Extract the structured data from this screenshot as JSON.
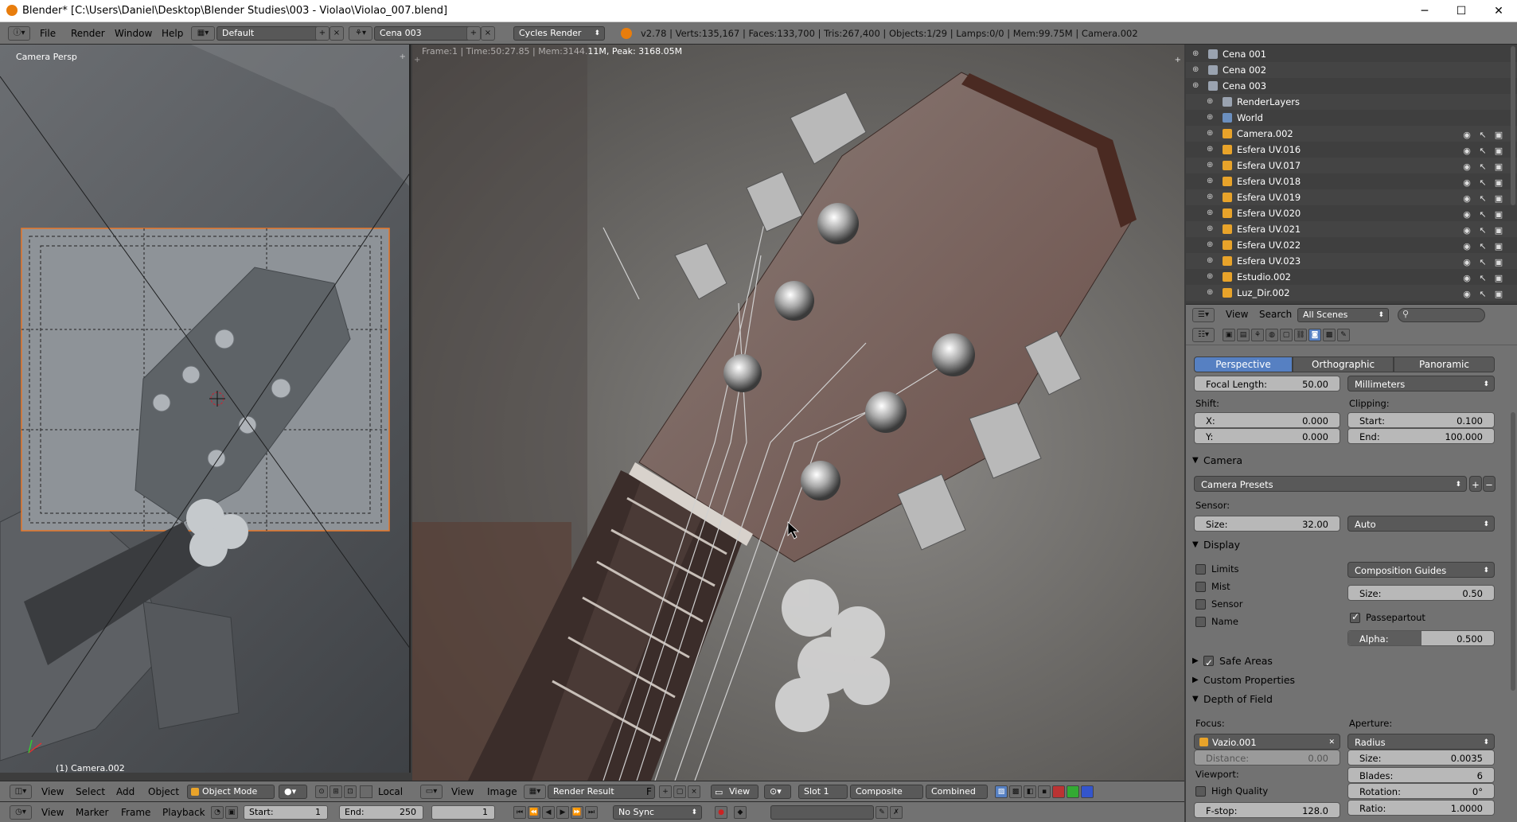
{
  "window": {
    "title": "Blender* [C:\\Users\\Daniel\\Desktop\\Blender Studies\\003 - Violao\\Violao_007.blend]",
    "minimize": "─",
    "maximize": "☐",
    "close": "✕"
  },
  "info_header": {
    "menus": [
      "File",
      "Render",
      "Window",
      "Help"
    ],
    "layout": "Default",
    "scene": "Cena 003",
    "engine": "Cycles Render",
    "stats": "v2.78 | Verts:135,167 | Faces:133,700 | Tris:267,400 | Objects:1/29 | Lamps:0/0 | Mem:99.75M | Camera.002"
  },
  "left_viewport": {
    "label": "Camera Persp",
    "object_label": "(1) Camera.002"
  },
  "render_view": {
    "frame_info": "Frame:1 | Time:50:27.85 | Mem:3144.11M, Peak: 3168.05M"
  },
  "outliner": {
    "items": [
      {
        "name": "Cena 001",
        "icon": "scene-icon",
        "indent": 0
      },
      {
        "name": "Cena 002",
        "icon": "scene-icon",
        "indent": 0
      },
      {
        "name": "Cena 003",
        "icon": "scene-icon",
        "indent": 0
      },
      {
        "name": "RenderLayers",
        "icon": "renderlayers-icon",
        "indent": 1
      },
      {
        "name": "World",
        "icon": "world-icon",
        "indent": 1
      },
      {
        "name": "Camera.002",
        "icon": "camera-icon",
        "indent": 1
      },
      {
        "name": "Esfera UV.016",
        "icon": "mesh-icon",
        "indent": 1
      },
      {
        "name": "Esfera UV.017",
        "icon": "mesh-icon",
        "indent": 1
      },
      {
        "name": "Esfera UV.018",
        "icon": "mesh-icon",
        "indent": 1
      },
      {
        "name": "Esfera UV.019",
        "icon": "mesh-icon",
        "indent": 1
      },
      {
        "name": "Esfera UV.020",
        "icon": "mesh-icon",
        "indent": 1
      },
      {
        "name": "Esfera UV.021",
        "icon": "mesh-icon",
        "indent": 1
      },
      {
        "name": "Esfera UV.022",
        "icon": "mesh-icon",
        "indent": 1
      },
      {
        "name": "Esfera UV.023",
        "icon": "mesh-icon",
        "indent": 1
      },
      {
        "name": "Estudio.002",
        "icon": "mesh-icon",
        "indent": 1
      },
      {
        "name": "Luz_Dir.002",
        "icon": "mesh-icon",
        "indent": 1
      }
    ],
    "header": {
      "view": "View",
      "search": "Search",
      "filter": "All Scenes"
    }
  },
  "properties": {
    "lens_types": [
      "Perspective",
      "Orthographic",
      "Panoramic"
    ],
    "focal_length_label": "Focal Length:",
    "focal_length": "50.00",
    "lens_unit": "Millimeters",
    "shift_label": "Shift:",
    "shift_x_label": "X:",
    "shift_x": "0.000",
    "shift_y_label": "Y:",
    "shift_y": "0.000",
    "clipping_label": "Clipping:",
    "clip_start_label": "Start:",
    "clip_start": "0.100",
    "clip_end_label": "End:",
    "clip_end": "100.000",
    "camera_section": "Camera",
    "camera_presets": "Camera Presets",
    "sensor_label": "Sensor:",
    "sensor_size_label": "Size:",
    "sensor_size": "32.00",
    "sensor_fit": "Auto",
    "display_section": "Display",
    "limits": "Limits",
    "mist": "Mist",
    "sensor": "Sensor",
    "name": "Name",
    "composition_guides": "Composition Guides",
    "display_size_label": "Size:",
    "display_size": "0.50",
    "passepartout": "Passepartout",
    "alpha_label": "Alpha:",
    "alpha": "0.500",
    "alpha_fill": 0.5,
    "safe_areas": "Safe Areas",
    "custom_properties": "Custom Properties",
    "dof_section": "Depth of Field",
    "focus_label": "Focus:",
    "focus_object": "Vazio.001",
    "distance_label": "Distance:",
    "distance": "0.00",
    "viewport_label": "Viewport:",
    "high_quality": "High Quality",
    "fstop_label": "F-stop:",
    "fstop": "128.0",
    "aperture_label": "Aperture:",
    "aperture_type": "Radius",
    "ap_size_label": "Size:",
    "ap_size": "0.0035",
    "blades_label": "Blades:",
    "blades": "6",
    "rotation_label": "Rotation:",
    "rotation": "0°",
    "ratio_label": "Ratio:",
    "ratio": "1.0000"
  },
  "image_editor_header": {
    "menus": [
      "View",
      "Image"
    ],
    "image": "Render Result",
    "f": "F",
    "view": "View",
    "slot": "Slot 1",
    "layer": "Composite",
    "pass": "Combined"
  },
  "viewport_header": {
    "menus": [
      "View",
      "Select",
      "Add",
      "Object"
    ],
    "mode": "Object Mode",
    "local": "Local"
  },
  "timeline": {
    "menus": [
      "View",
      "Marker",
      "Frame",
      "Playback"
    ],
    "start_label": "Start:",
    "start": "1",
    "end_label": "End:",
    "end": "250",
    "current": "1",
    "sync": "No Sync"
  }
}
